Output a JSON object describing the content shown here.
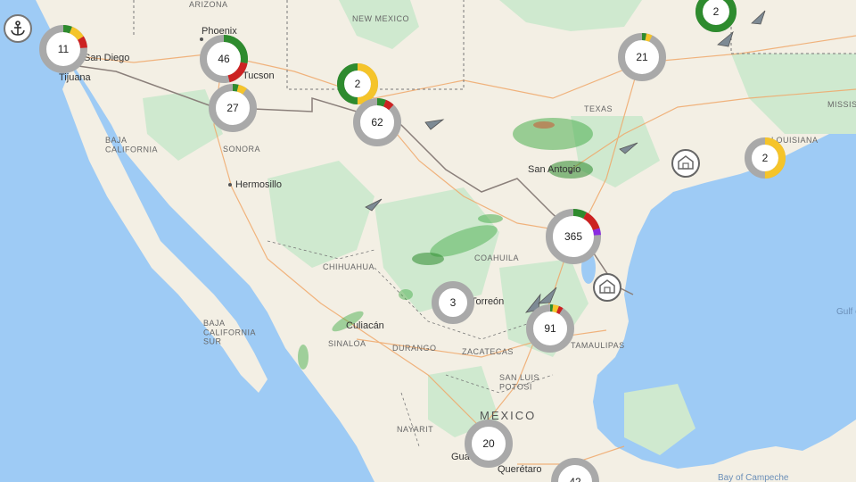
{
  "map": {
    "places": {
      "phoenix": "Phoenix",
      "tucson": "Tucson",
      "tijuana": "Tijuana",
      "san_diego": "San Diego",
      "hermosillo": "Hermosillo",
      "san_antonio": "San Antonio",
      "culiacan": "Culiacán",
      "torreon": "Torreón",
      "guadalajara": "Guadalajara",
      "queretaro": "Querétaro"
    },
    "regions": {
      "arizona": "ARIZONA",
      "new_mexico": "NEW MEXICO",
      "texas": "TEXAS",
      "louisiana": "LOUISIANA",
      "mississippi": "MISSISSIPPI",
      "baja_california": "BAJA\nCALIFORNIA",
      "baja_california_sur": "BAJA\nCALIFORNIA\nSUR",
      "sonora": "SONORA",
      "chihuahua": "CHIHUAHUA",
      "coahuila": "COAHUILA",
      "sinaloa": "SINALOA",
      "durango": "DURANGO",
      "zacatecas": "ZACATECAS",
      "san_luis_potosi": "SAN LUIS\nPOTOSÍ",
      "tamaulipas": "TAMAULIPAS",
      "nayarit": "NAYARIT"
    },
    "country": "MEXICO",
    "seas": {
      "gulf": "Gulf of Mexico",
      "bay": "Bay of Campeche"
    }
  },
  "clusters": [
    {
      "name": "cluster-san-diego",
      "count": "11",
      "segments": [
        {
          "color": "#2e8b2e",
          "frac": 0.06
        },
        {
          "color": "#f5c42a",
          "frac": 0.1
        },
        {
          "color": "#cc2222",
          "frac": 0.08
        }
      ]
    },
    {
      "name": "cluster-phoenix",
      "count": "46",
      "segments": [
        {
          "color": "#2e8b2e",
          "frac": 0.28
        },
        {
          "color": "#cc2222",
          "frac": 0.18
        }
      ]
    },
    {
      "name": "cluster-tucson",
      "count": "27",
      "segments": [
        {
          "color": "#2e8b2e",
          "frac": 0.04
        },
        {
          "color": "#f5c42a",
          "frac": 0.06
        }
      ]
    },
    {
      "name": "cluster-new-mexico",
      "count": "2",
      "segments": [
        {
          "color": "#f5c42a",
          "frac": 0.5
        },
        {
          "color": "#2e8b2e",
          "frac": 0.5
        }
      ]
    },
    {
      "name": "cluster-el-paso",
      "count": "62",
      "segments": [
        {
          "color": "#2e8b2e",
          "frac": 0.06
        },
        {
          "color": "#cc2222",
          "frac": 0.06
        }
      ]
    },
    {
      "name": "cluster-dallas",
      "count": "21",
      "segments": [
        {
          "color": "#2e8b2e",
          "frac": 0.03
        },
        {
          "color": "#f5c42a",
          "frac": 0.04
        }
      ]
    },
    {
      "name": "cluster-top-right",
      "count": "2",
      "segments": [
        {
          "color": "#2e8b2e",
          "frac": 1.0
        }
      ]
    },
    {
      "name": "cluster-louisiana",
      "count": "2",
      "segments": [
        {
          "color": "#f5c42a",
          "frac": 0.5
        }
      ]
    },
    {
      "name": "cluster-south-texas",
      "count": "365",
      "segments": [
        {
          "color": "#2e8b2e",
          "frac": 0.08
        },
        {
          "color": "#cc2222",
          "frac": 0.12
        },
        {
          "color": "#8a2be2",
          "frac": 0.04
        }
      ]
    },
    {
      "name": "cluster-torreon",
      "count": "3",
      "segments": []
    },
    {
      "name": "cluster-monterrey",
      "count": "91",
      "segments": [
        {
          "color": "#2e8b2e",
          "frac": 0.02
        },
        {
          "color": "#f5c42a",
          "frac": 0.04
        },
        {
          "color": "#cc2222",
          "frac": 0.03
        }
      ]
    },
    {
      "name": "cluster-guadalajara",
      "count": "20",
      "segments": []
    },
    {
      "name": "cluster-bottom",
      "count": "42",
      "segments": []
    }
  ],
  "icons": {
    "anchor": "anchor-icon",
    "arrows": "navigation-arrow-icon",
    "facility": "facility-icon"
  }
}
